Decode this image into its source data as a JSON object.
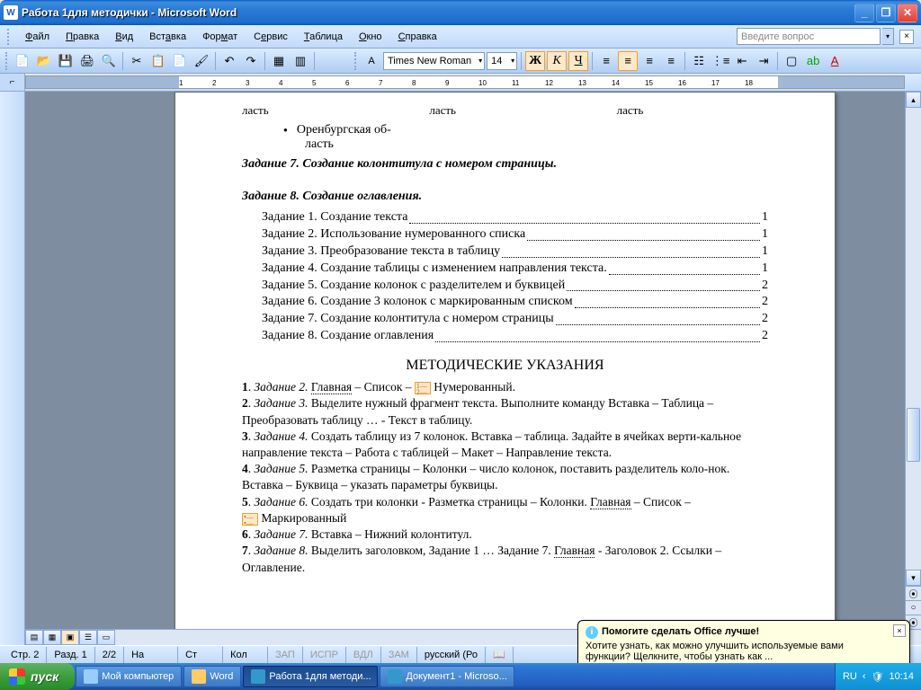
{
  "titlebar": {
    "title": "Работа 1для методички - Microsoft Word"
  },
  "menu": {
    "file": "Файл",
    "edit": "Правка",
    "view": "Вид",
    "insert": "Вставка",
    "format": "Формат",
    "tools": "Сервис",
    "table": "Таблица",
    "window": "Окно",
    "help": "Справка",
    "question_placeholder": "Введите вопрос"
  },
  "format_toolbar": {
    "font": "Times New Roman",
    "size": "14",
    "bold": "Ж",
    "italic": "К",
    "underline": "Ч"
  },
  "ruler": {
    "ticks": [
      "1",
      "2",
      "3",
      "4",
      "5",
      "6",
      "7",
      "8",
      "9",
      "10",
      "11",
      "12",
      "13",
      "14",
      "15",
      "16",
      "17",
      "18"
    ]
  },
  "doc": {
    "col_row": [
      "ласть",
      "ласть",
      "ласть"
    ],
    "bullet_text": "Оренбургская об-",
    "bullet_text2": "ласть",
    "h7": "Задание 7. Создание колонтитула с номером страницы.",
    "h8": "Задание 8. Создание оглавления.",
    "toc": [
      {
        "t": "Задание 1. Создание текста",
        "p": "1"
      },
      {
        "t": "Задание 2. Использование нумерованного списка",
        "p": "1"
      },
      {
        "t": "Задание 3. Преобразование текста в таблицу",
        "p": "1"
      },
      {
        "t": "Задание 4. Создание таблицы с изменением направления текста.",
        "p": "1"
      },
      {
        "t": "Задание 5. Создание колонок с разделителем и буквицей",
        "p": "2"
      },
      {
        "t": "Задание 6. Создание 3 колонок с маркированным списком",
        "p": "2"
      },
      {
        "t": "Задание 7. Создание колонтитула с номером страницы",
        "p": "2"
      },
      {
        "t": "Задание 8. Создание оглавления",
        "p": "2"
      }
    ],
    "big": "МЕТОДИЧЕСКИЕ УКАЗАНИЯ",
    "i1a": "1",
    "i1b": "Задание 2.",
    "i1c": "Главная",
    "i1d": " – Список – ",
    "i1e": "  Нумерованный.",
    "i2a": "2",
    "i2b": "Задание 3.",
    "i2c": " Выделите нужный фрагмент текста. Выполните команду Вставка – Таблица – Преобразовать таблицу …  -  Текст в таблицу.",
    "i3a": "3",
    "i3b": "Задание 4.",
    "i3c": " Создать таблицу из 7 колонок. Вставка – таблица. Задайте в ячейках верти-кальное направление текста – Работа с таблицей – Макет – Направление текста.",
    "i4a": "4",
    "i4b": "Задание 5.",
    "i4c": " Разметка страницы – Колонки – число колонок, поставить разделитель коло-нок.  Вставка – Буквица – указать параметры буквицы.",
    "i5a": "5",
    "i5b": "Задание 6.",
    "i5c": " Создать три колонки - Разметка страницы – Колонки. ",
    "i5d": "Главная",
    "i5e": " – Список – ",
    "i5f": " Маркированный",
    "i6a": "6",
    "i6b": "Задание 7.",
    "i6c": " Вставка – Нижний колонтитул.",
    "i7a": "7",
    "i7b": "Задание 8.",
    "i7c": " Выделить заголовком, Задание 1 … Задание 7. ",
    "i7d": "Главная",
    "i7e": " - Заголовок 2. Ссылки – Оглавление."
  },
  "status": {
    "page": "Стр. 2",
    "section": "Разд. 1",
    "pages": "2/2",
    "at": "На",
    "line": "Ст",
    "col": "Кол",
    "rec": "ЗАП",
    "trk": "ИСПР",
    "ext": "ВДЛ",
    "ovr": "ЗАМ",
    "lang": "русский (Ро"
  },
  "balloon": {
    "title": "Помогите сделать Office лучше!",
    "body": "Хотите узнать, как можно улучшить используемые вами функции?  Щелкните, чтобы узнать как ..."
  },
  "taskbar": {
    "start": "пуск",
    "items": [
      "Мой компьютер",
      "Word",
      "Работа 1для методи...",
      "Документ1 - Microso..."
    ],
    "lang": "RU",
    "time": "10:14"
  }
}
